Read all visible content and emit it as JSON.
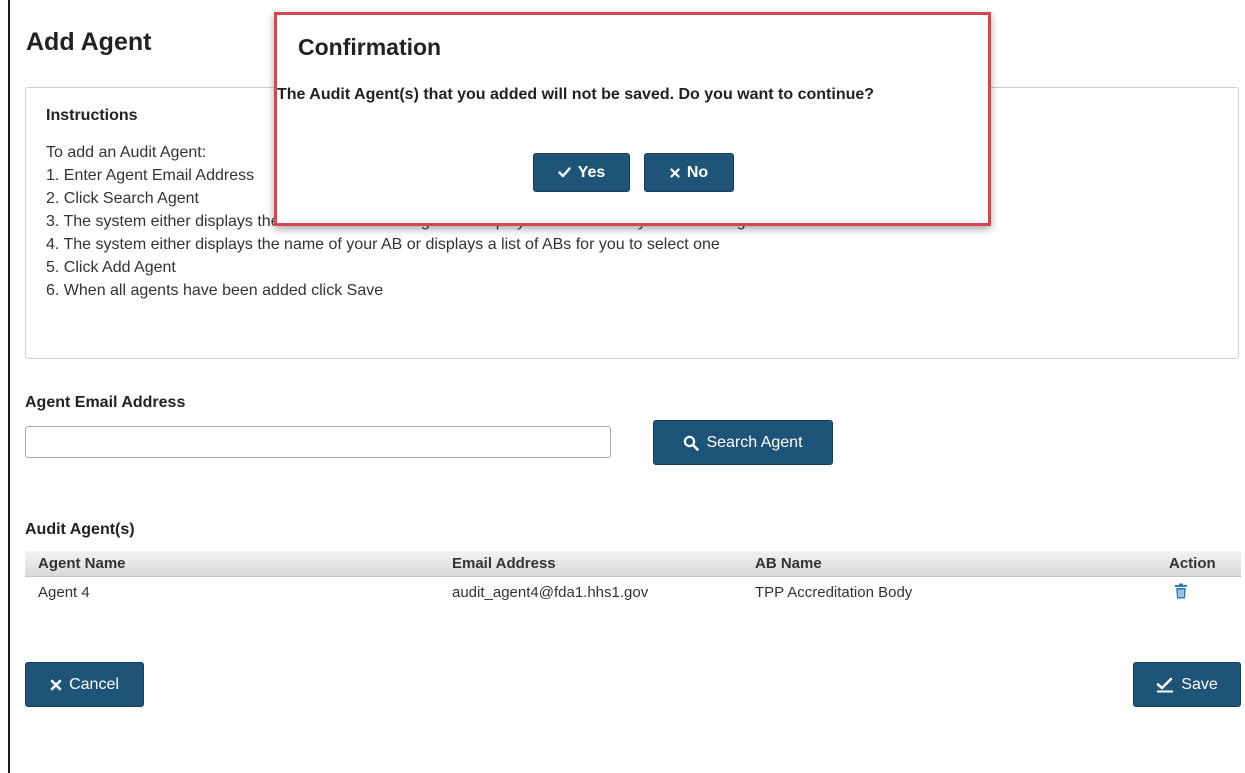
{
  "page": {
    "title": "Add Agent"
  },
  "instructions": {
    "title": "Instructions",
    "lines": [
      "To add an Audit Agent:",
      "1. Enter Agent Email Address",
      "2. Click Search Agent",
      "3. The system either displays the name of the audit agent or displays a text field for you to enter Agent Name",
      "4. The system either displays the name of your AB or displays a list of ABs for you to select one",
      "5. Click Add Agent",
      "6. When all agents have been added click Save"
    ]
  },
  "form": {
    "email_label": "Agent Email Address",
    "email_value": "",
    "search_label": "Search Agent"
  },
  "agents": {
    "title": "Audit Agent(s)",
    "columns": [
      "Agent Name",
      "Email Address",
      "AB Name",
      "Action"
    ],
    "rows": [
      {
        "name": "Agent 4",
        "email": "audit_agent4@fda1.hhs1.gov",
        "ab": "TPP Accreditation Body",
        "action_icon": "trash-icon"
      }
    ]
  },
  "footer": {
    "cancel_label": "Cancel",
    "save_label": "Save"
  },
  "dialog": {
    "title": "Confirmation",
    "message": "The Audit Agent(s) that you added will not be saved. Do you want to continue?",
    "yes_label": "Yes",
    "no_label": "No"
  },
  "colors": {
    "primary_button": "#1f5479",
    "dialog_border": "#d9454a",
    "trash_icon": "#2a7bbf"
  }
}
